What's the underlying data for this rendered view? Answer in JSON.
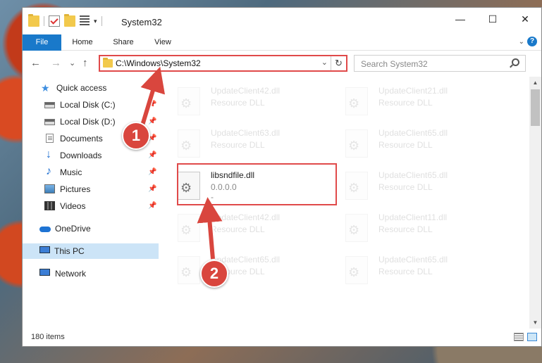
{
  "window": {
    "title": "System32",
    "controls": {
      "minimize": "—",
      "maximize": "☐",
      "close": "✕"
    }
  },
  "ribbon": {
    "tabs": [
      "File",
      "Home",
      "Share",
      "View"
    ],
    "expand": "⌄",
    "help": "?"
  },
  "nav": {
    "back": "←",
    "forward": "→",
    "recent": "⌄",
    "up": "↑",
    "address": "C:\\Windows\\System32",
    "address_dropdown": "⌄",
    "refresh": "↻",
    "search_placeholder": "Search System32"
  },
  "sidebar": {
    "items": [
      {
        "label": "Quick access",
        "icon": "star-icon",
        "pinned": false
      },
      {
        "label": "Local Disk (C:)",
        "icon": "disk-icon",
        "pinned": true
      },
      {
        "label": "Local Disk (D:)",
        "icon": "disk-icon",
        "pinned": true
      },
      {
        "label": "Documents",
        "icon": "documents-icon",
        "pinned": true
      },
      {
        "label": "Downloads",
        "icon": "download-icon",
        "pinned": true
      },
      {
        "label": "Music",
        "icon": "music-icon",
        "pinned": true
      },
      {
        "label": "Pictures",
        "icon": "pictures-icon",
        "pinned": true
      },
      {
        "label": "Videos",
        "icon": "videos-icon",
        "pinned": true
      },
      {
        "label": "OneDrive",
        "icon": "onedrive-icon",
        "pinned": false
      },
      {
        "label": "This PC",
        "icon": "this-pc-icon",
        "pinned": false,
        "selected": true
      },
      {
        "label": "Network",
        "icon": "network-icon",
        "pinned": false
      }
    ],
    "pin_glyph": "📌"
  },
  "files": [
    {
      "name": "UpdateClient42.dll",
      "desc": "Resource DLL",
      "faded": true
    },
    {
      "name": "UpdateClient21.dll",
      "desc": "Resource DLL",
      "faded": true
    },
    {
      "name": "UpdateClient63.dll",
      "desc": "Resource DLL",
      "faded": true
    },
    {
      "name": "UpdateClient65.dll",
      "desc": "Resource DLL",
      "faded": true
    },
    {
      "name": "libsndfile.dll",
      "desc": "0.0.0.0",
      "extra": "-",
      "faded": false
    },
    {
      "name": "UpdateClient65.dll",
      "desc": "Resource DLL",
      "faded": true
    },
    {
      "name": "UpdateClient42.dll",
      "desc": "Resource DLL",
      "faded": true
    },
    {
      "name": "UpdateClient11.dll",
      "desc": "Resource DLL",
      "faded": true
    },
    {
      "name": "UpdateClient65.dll",
      "desc": "Resource DLL",
      "faded": true
    },
    {
      "name": "UpdateClient65.dll",
      "desc": "Resource DLL",
      "faded": true
    }
  ],
  "status": {
    "item_count": "180 items"
  },
  "annotations": {
    "marker1": "1",
    "marker2": "2"
  },
  "colors": {
    "accent": "#1979ca",
    "highlight": "#e04a4a",
    "marker": "#d9463e"
  }
}
